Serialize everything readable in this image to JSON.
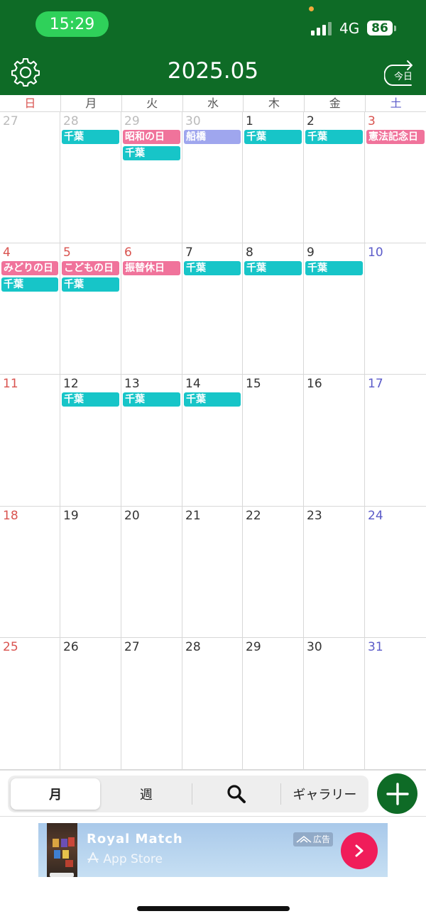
{
  "status_bar": {
    "time": "15:29",
    "network": "4G",
    "battery": "86",
    "colors": {
      "bar": "#0e6b26",
      "clock_pill": "#2fd15a"
    }
  },
  "header": {
    "title": "2025.05",
    "today_button": "今日",
    "settings_icon": "gear-icon"
  },
  "weekdays": [
    "日",
    "月",
    "火",
    "水",
    "木",
    "金",
    "土"
  ],
  "colors": {
    "sunday": "#d9534f",
    "saturday": "#5b5bc9",
    "holiday_event": "#f0739b",
    "chiba_event": "#17c5c8",
    "funabashi_event": "#9fa6ee"
  },
  "calendar": {
    "weeks": [
      [
        {
          "day": "27",
          "faded": true,
          "events": []
        },
        {
          "day": "28",
          "faded": true,
          "events": [
            {
              "label": "千葉",
              "kind": "chiba"
            }
          ]
        },
        {
          "day": "29",
          "faded": true,
          "events": [
            {
              "label": "昭和の日",
              "kind": "holiday"
            },
            {
              "label": "千葉",
              "kind": "chiba"
            }
          ]
        },
        {
          "day": "30",
          "faded": true,
          "events": [
            {
              "label": "船橋",
              "kind": "funabashi"
            }
          ]
        },
        {
          "day": "1",
          "events": [
            {
              "label": "千葉",
              "kind": "chiba"
            }
          ]
        },
        {
          "day": "2",
          "events": [
            {
              "label": "千葉",
              "kind": "chiba"
            }
          ]
        },
        {
          "day": "3",
          "red": true,
          "events": [
            {
              "label": "憲法記念日",
              "kind": "holiday"
            }
          ]
        }
      ],
      [
        {
          "day": "4",
          "events": [
            {
              "label": "みどりの日",
              "kind": "holiday"
            },
            {
              "label": "千葉",
              "kind": "chiba"
            }
          ]
        },
        {
          "day": "5",
          "red": true,
          "events": [
            {
              "label": "こどもの日",
              "kind": "holiday"
            },
            {
              "label": "千葉",
              "kind": "chiba"
            }
          ]
        },
        {
          "day": "6",
          "red": true,
          "events": [
            {
              "label": "振替休日",
              "kind": "holiday"
            }
          ]
        },
        {
          "day": "7",
          "events": [
            {
              "label": "千葉",
              "kind": "chiba"
            }
          ]
        },
        {
          "day": "8",
          "events": [
            {
              "label": "千葉",
              "kind": "chiba"
            }
          ]
        },
        {
          "day": "9",
          "events": [
            {
              "label": "千葉",
              "kind": "chiba"
            }
          ]
        },
        {
          "day": "10",
          "events": []
        }
      ],
      [
        {
          "day": "11",
          "events": []
        },
        {
          "day": "12",
          "events": [
            {
              "label": "千葉",
              "kind": "chiba"
            }
          ]
        },
        {
          "day": "13",
          "events": [
            {
              "label": "千葉",
              "kind": "chiba"
            }
          ]
        },
        {
          "day": "14",
          "events": [
            {
              "label": "千葉",
              "kind": "chiba"
            }
          ]
        },
        {
          "day": "15",
          "events": []
        },
        {
          "day": "16",
          "events": []
        },
        {
          "day": "17",
          "events": []
        }
      ],
      [
        {
          "day": "18",
          "events": []
        },
        {
          "day": "19",
          "events": []
        },
        {
          "day": "20",
          "events": []
        },
        {
          "day": "21",
          "events": []
        },
        {
          "day": "22",
          "events": []
        },
        {
          "day": "23",
          "events": []
        },
        {
          "day": "24",
          "events": []
        }
      ],
      [
        {
          "day": "25",
          "events": []
        },
        {
          "day": "26",
          "events": []
        },
        {
          "day": "27",
          "events": []
        },
        {
          "day": "28",
          "events": []
        },
        {
          "day": "29",
          "events": []
        },
        {
          "day": "30",
          "events": []
        },
        {
          "day": "31",
          "events": []
        }
      ]
    ]
  },
  "toolbar": {
    "month_label": "月",
    "week_label": "週",
    "search_icon": "search-icon",
    "gallery_label": "ギャラリー",
    "add_icon": "plus-icon"
  },
  "ad": {
    "title": "Royal Match",
    "store": "App Store",
    "badge": "広告"
  }
}
